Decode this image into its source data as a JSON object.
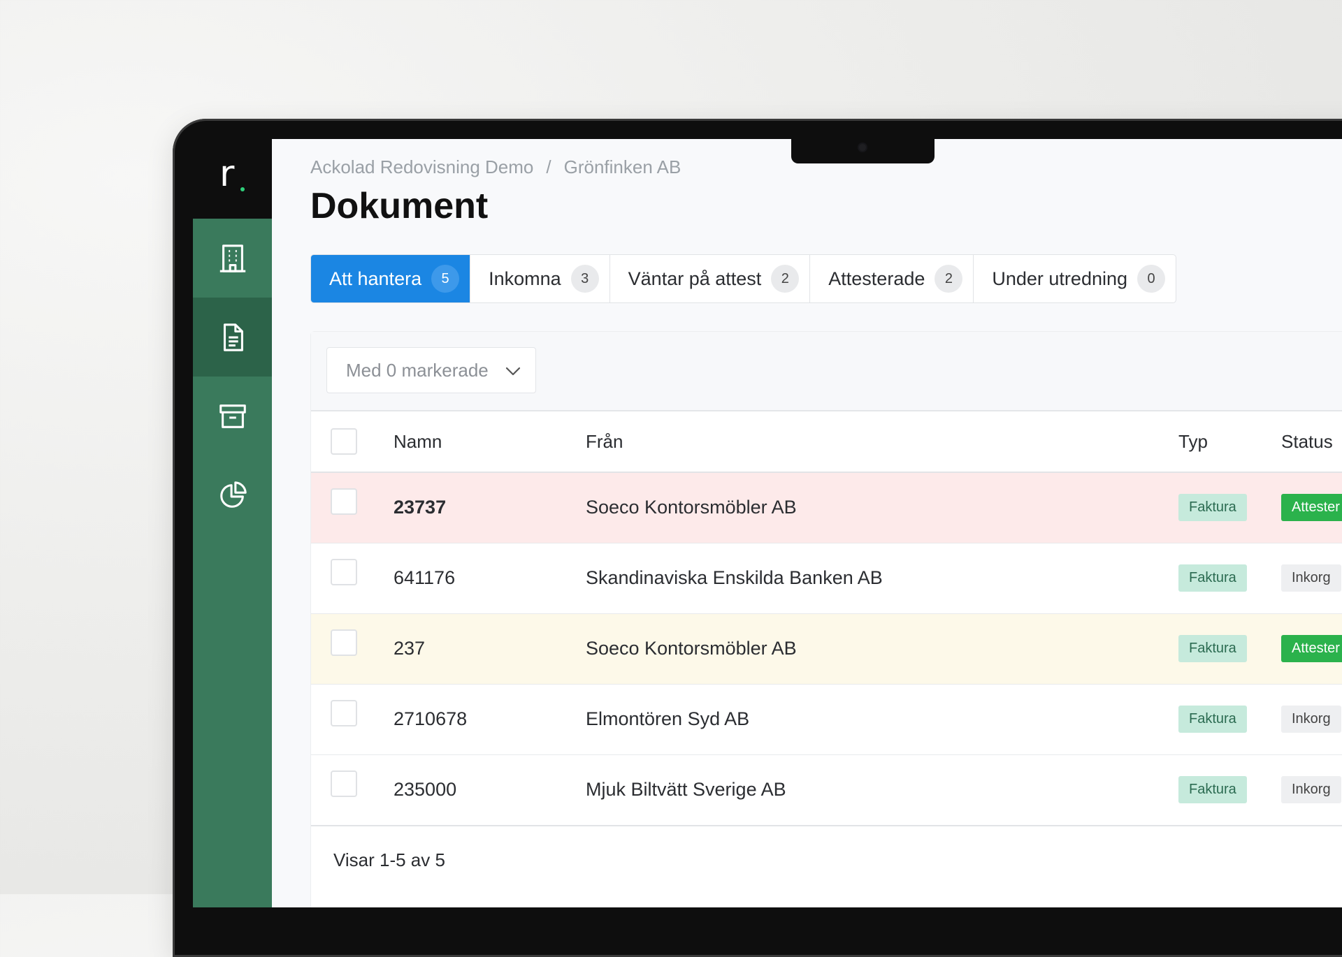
{
  "sidebar": {
    "logo_text": "r.",
    "items": [
      {
        "name": "company",
        "icon": "building-icon"
      },
      {
        "name": "documents",
        "icon": "document-icon",
        "active": true
      },
      {
        "name": "archive",
        "icon": "archive-icon"
      },
      {
        "name": "reports",
        "icon": "pie-chart-icon"
      }
    ]
  },
  "breadcrumb": {
    "parent": "Ackolad Redovisning Demo",
    "separator": "/",
    "current": "Grönfinken AB"
  },
  "page": {
    "title": "Dokument"
  },
  "tabs": [
    {
      "label": "Att hantera",
      "count": "5",
      "active": true
    },
    {
      "label": "Inkomna",
      "count": "3"
    },
    {
      "label": "Väntar på attest",
      "count": "2"
    },
    {
      "label": "Attesterade",
      "count": "2"
    },
    {
      "label": "Under utredning",
      "count": "0"
    }
  ],
  "toolbar": {
    "bulk_action_label": "Med 0 markerade"
  },
  "table": {
    "columns": {
      "name": "Namn",
      "from": "Från",
      "type": "Typ",
      "status": "Status"
    },
    "rows": [
      {
        "name": "23737",
        "from": "Soeco Kontorsmöbler AB",
        "type": "Faktura",
        "status": "Attester"
      },
      {
        "name": "641176",
        "from": "Skandinaviska Enskilda Banken AB",
        "type": "Faktura",
        "status": "Inkorg"
      },
      {
        "name": "237",
        "from": "Soeco Kontorsmöbler AB",
        "type": "Faktura",
        "status": "Attester"
      },
      {
        "name": "2710678",
        "from": "Elmontören Syd AB",
        "type": "Faktura",
        "status": "Inkorg"
      },
      {
        "name": "235000",
        "from": "Mjuk Biltvätt Sverige AB",
        "type": "Faktura",
        "status": "Inkorg"
      }
    ]
  },
  "footer": {
    "pagination_text": "Visar 1-5 av 5"
  },
  "colors": {
    "sidebar": "#3a7a5c",
    "sidebar_active": "#2c6349",
    "accent": "#1b86e3",
    "row_danger": "#fdeaea",
    "row_warning": "#fdf9e9",
    "badge_faktura": "#c6eadc",
    "badge_attested": "#2bb24c"
  }
}
